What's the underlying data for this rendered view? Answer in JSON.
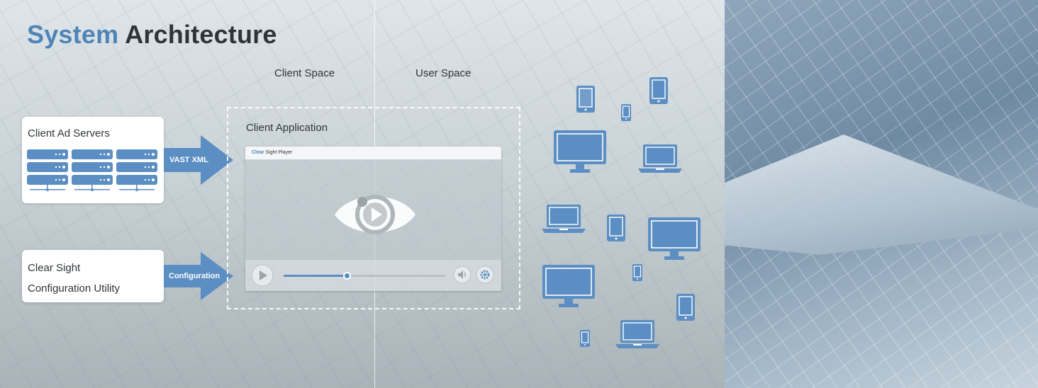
{
  "title": {
    "part1": "System",
    "part2": "Architecture"
  },
  "spaces": {
    "client": "Client Space",
    "user": "User Space"
  },
  "ad_servers": {
    "title": "Client Ad Servers"
  },
  "arrows": {
    "vast": "VAST XML",
    "config": "Configuration"
  },
  "config_utility": {
    "line1": "Clear Sight",
    "line2": "Configuration Utility"
  },
  "client_app": {
    "title": "Client Application"
  },
  "player": {
    "brand": "Clear",
    "name": "Sight Player",
    "progress": 0.39
  },
  "devices": [
    "tablet-icon",
    "tablet-icon",
    "phone-icon",
    "monitor-icon",
    "laptop-icon",
    "laptop-icon",
    "tablet-icon",
    "monitor-icon",
    "monitor-icon",
    "phone-icon",
    "tablet-icon",
    "phone-icon",
    "laptop-icon"
  ],
  "colors": {
    "accent": "#4f84b8",
    "dark": "#2f3438",
    "arrow": "#5b8ec2"
  }
}
